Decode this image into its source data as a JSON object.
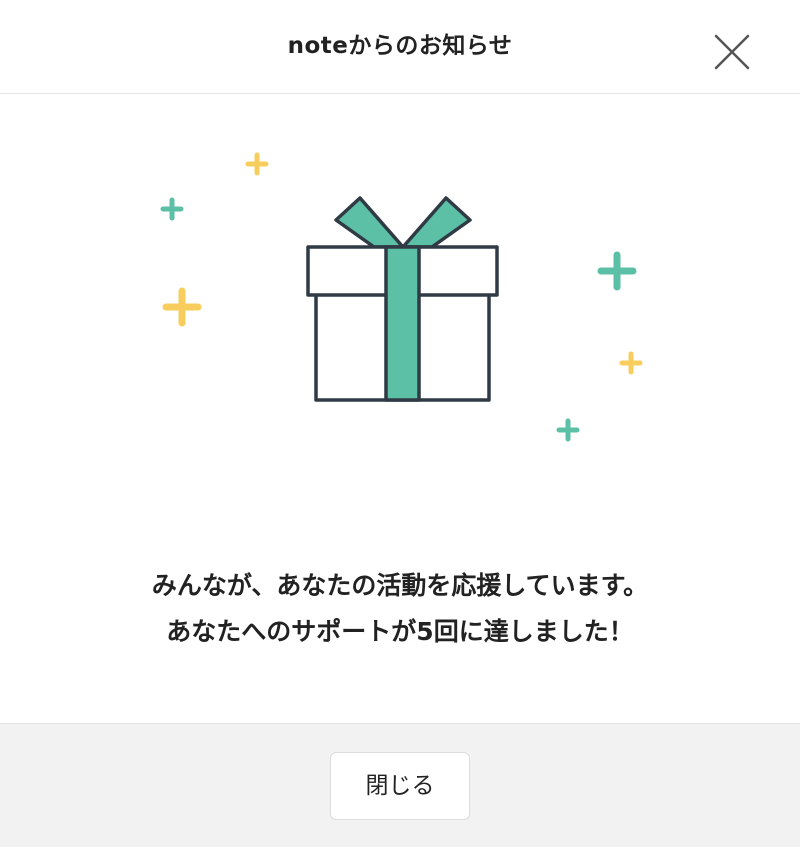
{
  "header": {
    "title": "noteからのお知らせ",
    "close_icon": "close-icon"
  },
  "illustration": {
    "icon": "gift-box-icon",
    "sparkle_colors": {
      "teal": "#5bc0a6",
      "yellow": "#f7cd5d"
    },
    "ribbon_color": "#5bc0a6",
    "outline_color": "#2f3a45"
  },
  "message": {
    "line1": "みんなが、あなたの活動を応援しています。",
    "line2": "あなたへのサポートが5回に達しました！"
  },
  "footer": {
    "close_label": "閉じる",
    "background": "#f2f2f2"
  }
}
